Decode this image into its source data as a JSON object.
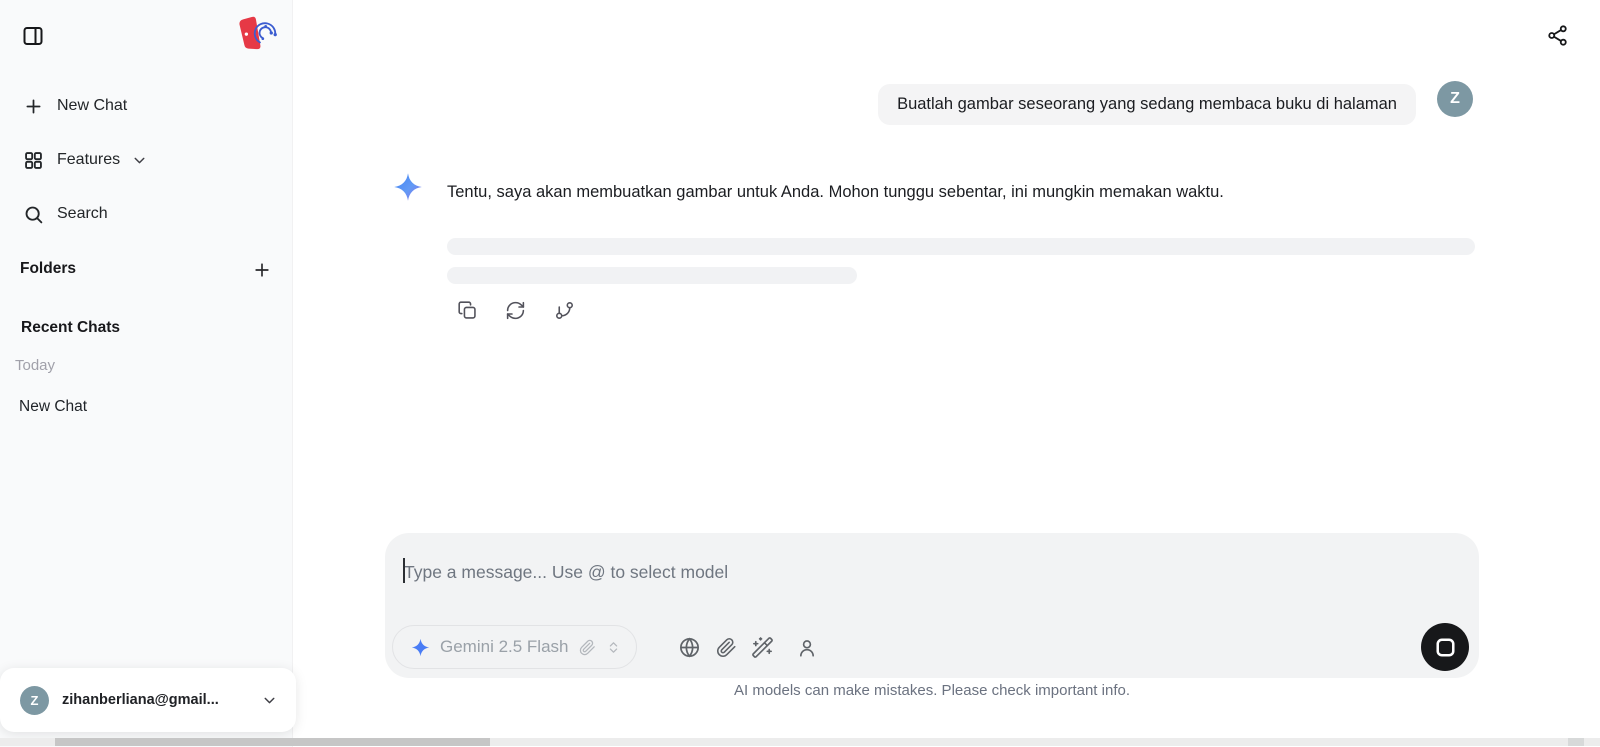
{
  "sidebar": {
    "items": [
      {
        "label": "New Chat"
      },
      {
        "label": "Features"
      },
      {
        "label": "Search"
      }
    ],
    "folders_header": "Folders",
    "recent_chats_header": "Recent Chats",
    "today_label": "Today",
    "recent_items": [
      {
        "label": "New Chat"
      }
    ],
    "account": {
      "email": "zihanberliana@gmail...",
      "avatar_initial": "Z"
    }
  },
  "chat": {
    "user_message": {
      "text": "Buatlah gambar seseorang yang sedang membaca buku di halaman",
      "avatar_initial": "Z"
    },
    "assistant_message": {
      "text": "Tentu, saya akan membuatkan gambar untuk Anda. Mohon tunggu sebentar, ini mungkin memakan waktu."
    }
  },
  "composer": {
    "placeholder": "Type a message... Use @ to select model",
    "model_selector": {
      "model_name": "Gemini 2.5 Flash"
    },
    "disclaimer": "AI models can make mistakes. Please check important info."
  },
  "icons": {
    "sidebar_toggle": "panel-left",
    "logo": "brand-mark",
    "share": "share-nodes",
    "message_actions": [
      "copy",
      "regenerate",
      "git-branch"
    ],
    "composer_icons": [
      "globe",
      "paperclip",
      "wand-sparkles",
      "user"
    ],
    "mic": "microphone",
    "stop": "stop-square"
  },
  "colors": {
    "gemini_blue": "#4285f4",
    "gemini_purple": "#8b6ce8",
    "logo_red": "#e63946",
    "logo_blue": "#3b5cd0",
    "avatar_bg": "#7d98a3",
    "user_bubble_bg": "#f4f4f5",
    "composer_bg": "#f2f3f4",
    "sidebar_bg": "#f9fafb"
  }
}
